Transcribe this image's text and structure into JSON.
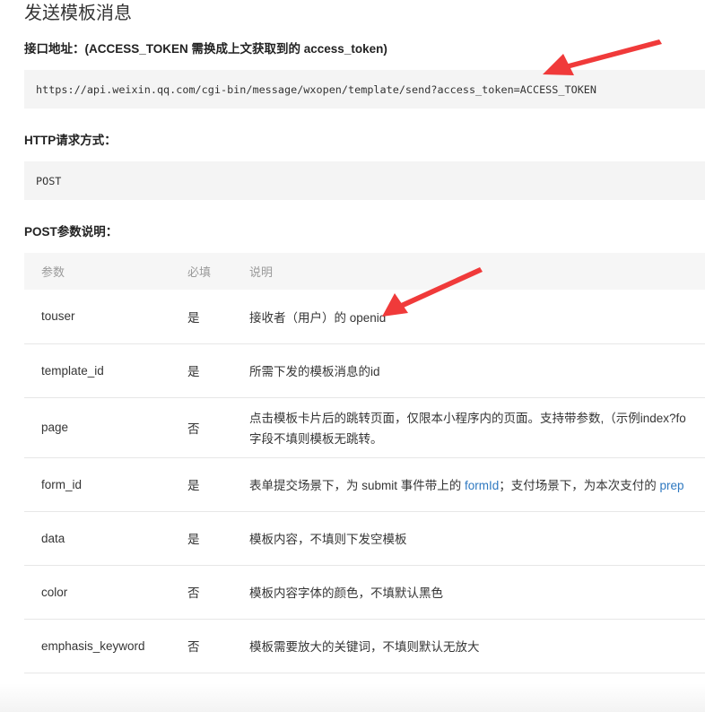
{
  "page": {
    "title": "发送模板消息",
    "endpoint_label": "接口地址：(ACCESS_TOKEN 需换成上文获取到的 access_token)",
    "endpoint_url": "https://api.weixin.qq.com/cgi-bin/message/wxopen/template/send?access_token=ACCESS_TOKEN",
    "method_label": "HTTP请求方式：",
    "method_value": "POST",
    "params_label": "POST参数说明："
  },
  "table": {
    "headers": [
      "参数",
      "必填",
      "说明"
    ],
    "rows": [
      {
        "param": "touser",
        "required": "是",
        "desc": "接收者（用户）的 openid"
      },
      {
        "param": "template_id",
        "required": "是",
        "desc": "所需下发的模板消息的id"
      },
      {
        "param": "page",
        "required": "否",
        "desc_line1": "点击模板卡片后的跳转页面，仅限本小程序内的页面。支持带参数,（示例index?fo",
        "desc_line2": "字段不填则模板无跳转。"
      },
      {
        "param": "form_id",
        "required": "是",
        "desc_pre": "表单提交场景下，为 submit 事件带上的 ",
        "desc_link1": "formId",
        "desc_mid": "；支付场景下，为本次支付的 ",
        "desc_link2": "prep"
      },
      {
        "param": "data",
        "required": "是",
        "desc": "模板内容，不填则下发空模板"
      },
      {
        "param": "color",
        "required": "否",
        "desc": "模板内容字体的颜色，不填默认黑色"
      },
      {
        "param": "emphasis_keyword",
        "required": "否",
        "desc": "模板需要放大的关键词，不填则默认无放大"
      }
    ]
  },
  "colors": {
    "annotation_arrow": "#f03a3a",
    "link": "#2e78c0",
    "code_bg": "#f4f4f4"
  }
}
